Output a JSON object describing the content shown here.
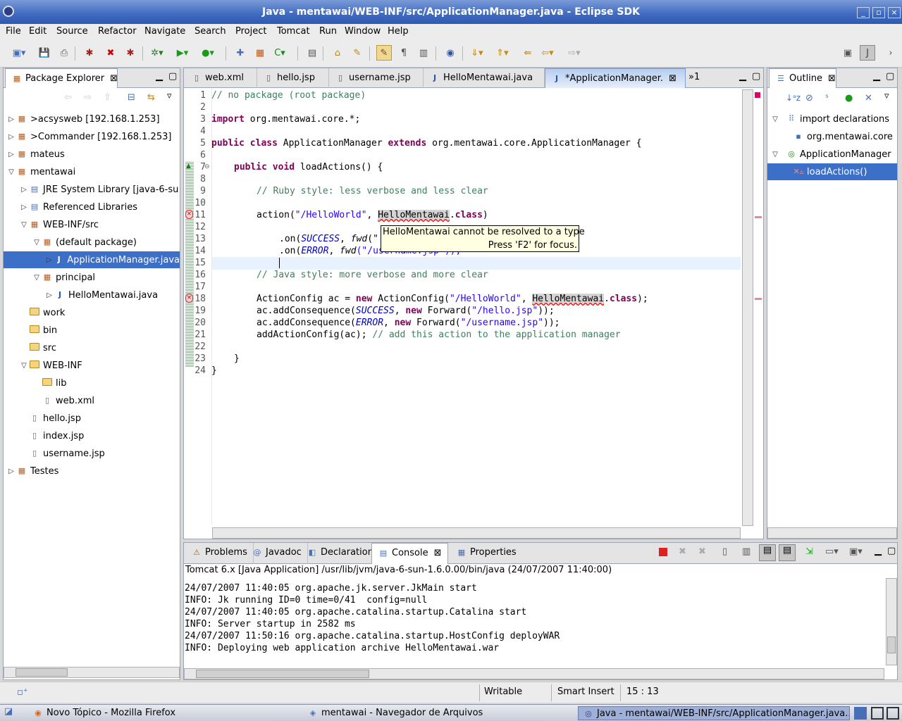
{
  "window": {
    "title": "Java - mentawai/WEB-INF/src/ApplicationManager.java - Eclipse SDK"
  },
  "menu": [
    "File",
    "Edit",
    "Source",
    "Refactor",
    "Navigate",
    "Search",
    "Project",
    "Tomcat",
    "Run",
    "Window",
    "Help"
  ],
  "package_explorer": {
    "title": "Package Explorer",
    "items": [
      {
        "label": ">acsysweb  [192.168.1.253]",
        "depth": 0,
        "arrow": "right"
      },
      {
        "label": ">Commander  [192.168.1.253]",
        "depth": 0,
        "arrow": "right"
      },
      {
        "label": "mateus",
        "depth": 0,
        "arrow": "right"
      },
      {
        "label": "mentawai",
        "depth": 0,
        "arrow": "down"
      },
      {
        "label": "JRE System Library [java-6-su",
        "depth": 1,
        "arrow": "right"
      },
      {
        "label": "Referenced Libraries",
        "depth": 1,
        "arrow": "right"
      },
      {
        "label": "WEB-INF/src",
        "depth": 1,
        "arrow": "down"
      },
      {
        "label": "(default package)",
        "depth": 2,
        "arrow": "down"
      },
      {
        "label": "ApplicationManager.java",
        "depth": 3,
        "arrow": "right",
        "selected": true
      },
      {
        "label": "principal",
        "depth": 2,
        "arrow": "down"
      },
      {
        "label": "HelloMentawai.java",
        "depth": 3,
        "arrow": "right"
      },
      {
        "label": "work",
        "depth": 1,
        "arrow": ""
      },
      {
        "label": "bin",
        "depth": 1,
        "arrow": ""
      },
      {
        "label": "src",
        "depth": 1,
        "arrow": ""
      },
      {
        "label": "WEB-INF",
        "depth": 1,
        "arrow": "down"
      },
      {
        "label": "lib",
        "depth": 2,
        "arrow": ""
      },
      {
        "label": "web.xml",
        "depth": 2,
        "arrow": ""
      },
      {
        "label": "hello.jsp",
        "depth": 1,
        "arrow": ""
      },
      {
        "label": "index.jsp",
        "depth": 1,
        "arrow": ""
      },
      {
        "label": "username.jsp",
        "depth": 1,
        "arrow": ""
      },
      {
        "label": "Testes",
        "depth": 0,
        "arrow": "right"
      }
    ]
  },
  "editor": {
    "tabs": [
      "web.xml",
      "hello.jsp",
      "username.jsp",
      "HelloMentawai.java",
      "*ApplicationManager."
    ],
    "overflow": "»1",
    "tooltip": {
      "message": "HelloMentawai cannot be resolved to a type",
      "hint": "Press 'F2' for focus."
    },
    "line_numbers": [
      "1",
      "2",
      "3",
      "4",
      "5",
      "6",
      "7",
      "8",
      "9",
      "10",
      "11",
      "12",
      "13",
      "14",
      "15",
      "16",
      "17",
      "18",
      "19",
      "20",
      "21",
      "22",
      "23",
      "24"
    ]
  },
  "outline": {
    "title": "Outline",
    "items": [
      {
        "label": "import declarations",
        "arrow": "down"
      },
      {
        "label": "org.mentawai.core",
        "arrow": ""
      },
      {
        "label": "ApplicationManager",
        "arrow": "down"
      },
      {
        "label": "loadActions()",
        "arrow": "",
        "selected": true
      }
    ]
  },
  "bottom": {
    "tabs": [
      "Problems",
      "Javadoc",
      "Declaration",
      "Console",
      "Properties"
    ],
    "console_header": "Tomcat 6.x [Java Application] /usr/lib/jvm/java-6-sun-1.6.0.00/bin/java (24/07/2007 11:40:00)",
    "console_lines": [
      "24/07/2007 11:40:05 org.apache.jk.server.JkMain start",
      "INFO: Jk running ID=0 time=0/41  config=null",
      "24/07/2007 11:40:05 org.apache.catalina.startup.Catalina start",
      "INFO: Server startup in 2582 ms",
      "24/07/2007 11:50:16 org.apache.catalina.startup.HostConfig deployWAR",
      "INFO: Deploying web application archive HelloMentawai.war"
    ]
  },
  "status": {
    "writable": "Writable",
    "insert": "Smart Insert",
    "position": "15 : 13"
  },
  "taskbar": [
    "Novo Tópico - Mozilla Firefox",
    "mentawai - Navegador de Arquivos",
    "Java - mentawai/WEB-INF/src/ApplicationManager.java..."
  ],
  "code": {
    "l1": "// no package (root package)",
    "l3a": "import",
    "l3b": " org.mentawai.core.*;",
    "l5a": "public",
    "l5b": "class",
    "l5c": " ApplicationManager ",
    "l5d": "extends",
    "l5e": " org.mentawai.core.ApplicationManager {",
    "l7a": "public",
    "l7b": "void",
    "l7c": " loadActions() {",
    "l9": "// Ruby style: less verbose and less clear",
    "l11a": "action(",
    "l11b": "\"/HelloWorld\"",
    "l11c": ", ",
    "l11d": "HelloMentawai",
    "l11e": ".",
    "l11f": "class",
    "l11g": ")",
    "l13a": ".on(",
    "l13b": "SUCCESS",
    "l13c": ", ",
    "l13d": "fwd",
    "l13e": "(\"",
    "l14a": ".on(",
    "l14b": "ERROR",
    "l14c": ", ",
    "l14d": "fwd",
    "l14e": "(\"/username.jsp\"));",
    "l16": "// Java style: more verbose and more clear",
    "l18a": "ActionConfig ac = ",
    "l18b": "new",
    "l18c": " ActionConfig(",
    "l18d": "\"/HelloWorld\"",
    "l18e": ", ",
    "l18f": "HelloMentawai",
    "l18g": ".",
    "l18h": "class",
    "l18i": ");",
    "l19a": "ac.addConsequence(",
    "l19b": "SUCCESS",
    "l19c": ", ",
    "l19d": "new",
    "l19e": " Forward(",
    "l19f": "\"/hello.jsp\"",
    "l19g": "));",
    "l20a": "ac.addConsequence(",
    "l20b": "ERROR",
    "l20c": ", ",
    "l20d": "new",
    "l20e": " Forward(",
    "l20f": "\"/username.jsp\"",
    "l20g": "));",
    "l21a": "addActionConfig(ac); ",
    "l21b": "// add this action to the application manager",
    "l23": "}",
    "l24": "}"
  }
}
